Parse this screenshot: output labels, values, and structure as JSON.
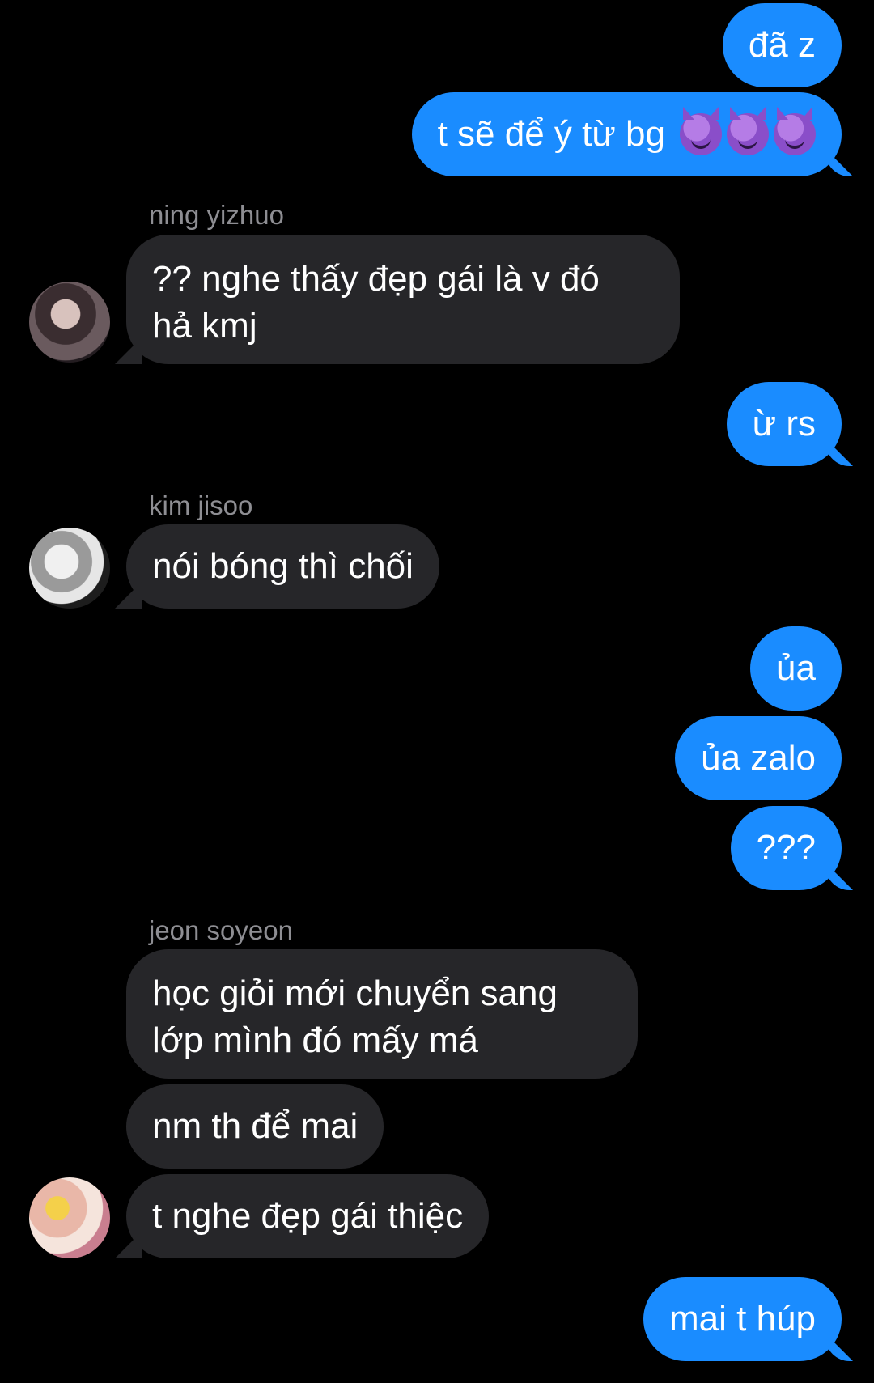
{
  "messages": [
    {
      "id": "m1",
      "direction": "outgoing",
      "text": "đã z"
    },
    {
      "id": "m2",
      "direction": "outgoing",
      "text": "t sẽ để ý từ bg",
      "emoji": [
        "smiling-devil",
        "smiling-devil",
        "smiling-devil"
      ]
    },
    {
      "id": "m3",
      "direction": "incoming",
      "sender": "ning yizhuo",
      "lines": [
        "?? nghe thấy đẹp gái là v đó",
        "hả kmj"
      ]
    },
    {
      "id": "m4",
      "direction": "outgoing",
      "text": "ừ rs"
    },
    {
      "id": "m5",
      "direction": "incoming",
      "sender": "kim jisoo",
      "text": "nói bóng thì chối"
    },
    {
      "id": "m6",
      "direction": "outgoing",
      "text": "ủa"
    },
    {
      "id": "m7",
      "direction": "outgoing",
      "text": "ủa zalo"
    },
    {
      "id": "m8",
      "direction": "outgoing",
      "text": "???"
    },
    {
      "id": "m9",
      "direction": "incoming",
      "sender": "jeon soyeon",
      "lines": [
        "học giỏi mới chuyển sang",
        "lớp mình đó mấy má"
      ]
    },
    {
      "id": "m10",
      "direction": "incoming",
      "text": "nm th để mai"
    },
    {
      "id": "m11",
      "direction": "incoming",
      "text": "t nghe đẹp gái thiệc"
    },
    {
      "id": "m12",
      "direction": "outgoing",
      "text": "mai t húp"
    }
  ],
  "colors": {
    "background": "#000000",
    "outgoing_bubble": "#1a8cff",
    "incoming_bubble": "#262629",
    "sender_name": "#8e8e93",
    "text": "#ffffff"
  }
}
